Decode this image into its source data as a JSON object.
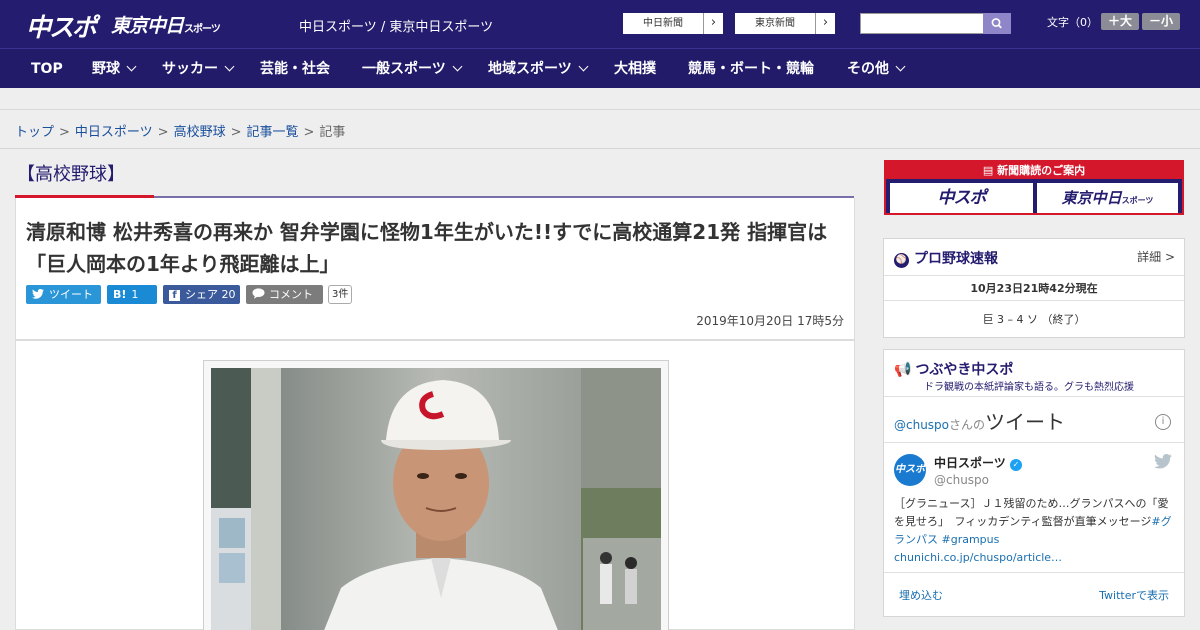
{
  "header": {
    "logo_chuspo": "中スポ",
    "logo_tokyo": "東京中日",
    "logo_tokyo_small": "スポーツ",
    "site_name": "中日スポーツ / 東京中日スポーツ",
    "ext_link_1": "中日新聞",
    "ext_link_2": "東京新聞",
    "search_value": "",
    "font_size_label": "文字（0）",
    "font_bigger": "＋大",
    "font_smaller": "－小",
    "brand_color": "#241c6e"
  },
  "nav": {
    "items": [
      {
        "label": "TOP"
      },
      {
        "label": "野球"
      },
      {
        "label": "サッカー"
      },
      {
        "label": "芸能・社会"
      },
      {
        "label": "一般スポーツ"
      },
      {
        "label": "地域スポーツ"
      },
      {
        "label": "大相撲"
      },
      {
        "label": "競馬・ボート・競輪"
      },
      {
        "label": "その他"
      }
    ]
  },
  "breadcrumb": {
    "items": [
      "トップ",
      "中日スポーツ",
      "高校野球",
      "記事一覧"
    ],
    "current": "記事",
    "separator": ">"
  },
  "article": {
    "category": "【高校野球】",
    "headline": "清原和博 松井秀喜の再来か 智弁学園に怪物1年生がいた!!すでに高校通算21発 指揮官は「巨人岡本の1年より飛距離は上」",
    "share": {
      "tweet": "ツイート",
      "hatena_label": "B!",
      "hatena_count": "1",
      "facebook_label": "シェア",
      "facebook_count": "20",
      "comment_label": "コメント",
      "comment_count": "3件"
    },
    "date": "2019年10月20日 17時5分"
  },
  "sidebar": {
    "subscribe": {
      "title": "新聞購読のご案内",
      "chuspo": "中スポ",
      "tokyo": "東京中日",
      "tokyo_small": "スポーツ"
    },
    "baseball": {
      "title": "プロ野球速報",
      "detail": "詳細 >",
      "timestamp": "10月23日21時42分現在",
      "score": "巨 3 – 4 ソ （終了）"
    },
    "tweets": {
      "title": "つぶやき中スポ",
      "subtitle": "ドラ観戦の本紙評論家も語る。グラも熱烈応援",
      "handle": "@chuspo",
      "handle_suffix": "さんの",
      "tweet_word": "ツイート",
      "info": "i",
      "account_name": "中日スポーツ",
      "account_handle": "@chuspo",
      "post": "［グラニュース］Ｊ１残留のため…グランパスへの「愛を見せろ」　フィッカデンティ監督が直筆メッセージ",
      "hashtags": "#グランパス #grampus",
      "link": "chunichi.co.jp/chuspo/article…",
      "embed": "埋め込む",
      "view_on_twitter": "Twitterで表示"
    }
  }
}
